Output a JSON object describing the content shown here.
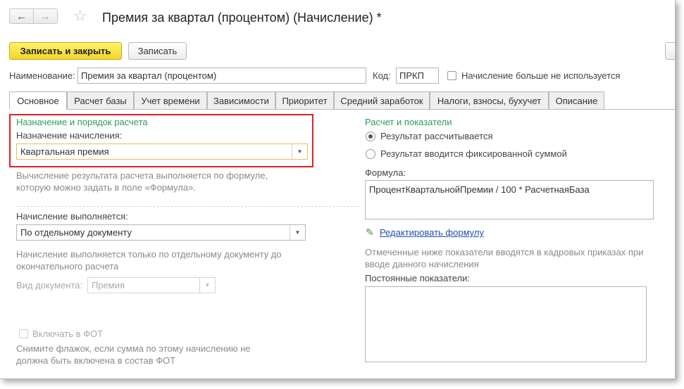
{
  "window": {
    "title": "Премия за квартал (процентом) (Начисление) *"
  },
  "nav": {
    "back_icon": "←",
    "forward_icon": "→",
    "star_icon": "☆"
  },
  "toolbar": {
    "save_close_label": "Записать и закрыть",
    "save_label": "Записать"
  },
  "header": {
    "name_label": "Наименование:",
    "name_value": "Премия за квартал (процентом)",
    "code_label": "Код:",
    "code_value": "ПРКП",
    "unused_label": "Начисление больше не используется"
  },
  "tabs": [
    "Основное",
    "Расчет базы",
    "Учет времени",
    "Зависимости",
    "Приоритет",
    "Средний заработок",
    "Налоги, взносы, бухучет",
    "Описание"
  ],
  "left": {
    "section_title": "Назначение и порядок расчета",
    "purpose_label": "Назначение начисления:",
    "purpose_value": "Квартальная премия",
    "purpose_hint_1": "Вычисление результата расчета выполняется по формуле,",
    "purpose_hint_2": "которую можно задать в поле «Формула».",
    "performed_label": "Начисление выполняется:",
    "performed_value": "По отдельному документу",
    "performed_hint_1": "Начисление выполняется только по отдельному документу до",
    "performed_hint_2": "окончательного расчета",
    "doctype_label": "Вид документа:",
    "doctype_value": "Премия",
    "fot_label": "Включать в ФОТ",
    "fot_hint_1": "Снимите флажок, если сумма по этому начислению не",
    "fot_hint_2": "должна быть включена в состав ФОТ"
  },
  "right": {
    "section_title": "Расчет и показатели",
    "radio_calc": "Результат рассчитывается",
    "radio_fixed": "Результат вводится фиксированной суммой",
    "formula_label": "Формула:",
    "formula_value": "ПроцентКвартальнойПремии / 100 * РасчетнаяБаза",
    "edit_formula_link": "Редактировать формулу",
    "indicators_hint_1": "Отмеченные ниже показатели вводятся в кадровых приказах при",
    "indicators_hint_2": "вводе данного начисления",
    "constant_label": "Постоянные показатели:"
  },
  "colors": {
    "accent_green": "#2a9d5a",
    "highlight_red": "#e02020",
    "primary_button": "#f2d52a",
    "link_blue": "#1d4fa8"
  }
}
